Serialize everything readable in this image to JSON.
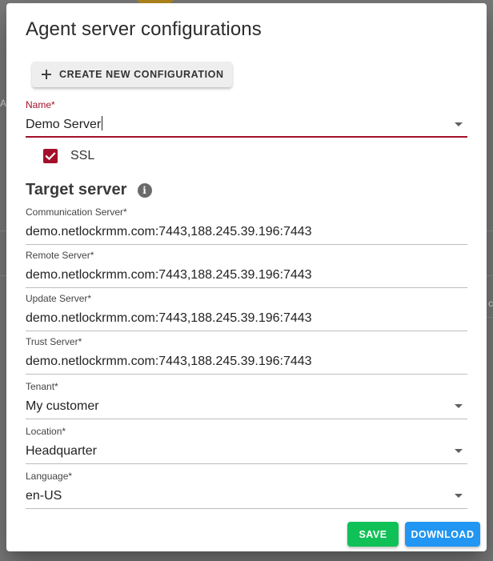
{
  "dialog": {
    "title": "Agent server configurations",
    "create_button_label": "CREATE NEW CONFIGURATION"
  },
  "name_field": {
    "label": "Name*",
    "value": "Demo Server"
  },
  "ssl": {
    "label": "SSL",
    "checked": true
  },
  "target_server": {
    "title": "Target server",
    "info_icon": "info-icon",
    "fields": [
      {
        "label": "Communication Server*",
        "value": "demo.netlockrmm.com:7443,188.245.39.196:7443"
      },
      {
        "label": "Remote Server*",
        "value": "demo.netlockrmm.com:7443,188.245.39.196:7443"
      },
      {
        "label": "Update Server*",
        "value": "demo.netlockrmm.com:7443,188.245.39.196:7443"
      },
      {
        "label": "Trust Server*",
        "value": "demo.netlockrmm.com:7443,188.245.39.196:7443"
      }
    ]
  },
  "selects": {
    "tenant": {
      "label": "Tenant*",
      "value": "My customer"
    },
    "location": {
      "label": "Location*",
      "value": "Headquarter"
    },
    "language": {
      "label": "Language*",
      "value": "en-US"
    }
  },
  "actions": {
    "save_label": "SAVE",
    "download_label": "DOWNLOAD"
  },
  "colors": {
    "accent": "#a3102a",
    "save": "#0fc157",
    "download": "#2196f3"
  },
  "background": {
    "left_text": "Ar",
    "right_text": "c"
  }
}
